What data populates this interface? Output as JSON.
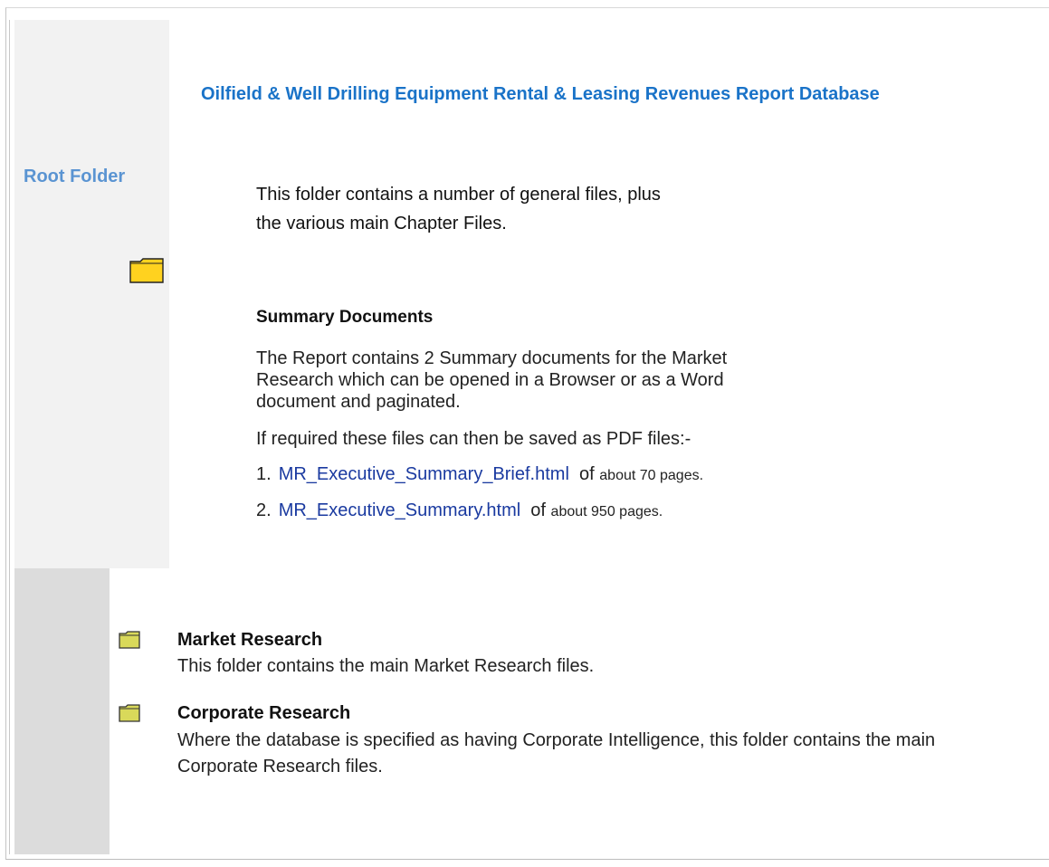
{
  "title": "Oilfield & Well Drilling Equipment Rental & Leasing Revenues Report Database",
  "left_label": "Root Folder",
  "intro_text": "This folder contains a number of general files, plus the various main Chapter Files.",
  "summary": {
    "heading": "Summary Documents",
    "paragraph1": "The Report contains 2 Summary documents for the Market Research which can be opened in a Browser or as a Word document and paginated.",
    "paragraph2": "If required these files can then be saved as PDF files:-",
    "items": [
      {
        "num": "1.",
        "link": "MR_Executive_Summary_Brief.html",
        "of": "of",
        "pages": "about 70 pages."
      },
      {
        "num": "2.",
        "link": "MR_Executive_Summary.html",
        "of": "of",
        "pages": "about 950 pages."
      }
    ]
  },
  "folders": [
    {
      "title": "Market Research",
      "description": "This folder contains the main Market Research files."
    },
    {
      "title": "Corporate Research",
      "description": "Where the database is specified as having Corporate Intelligence, this folder contains the main Corporate Research files."
    }
  ],
  "colors": {
    "title": "#1a73c8",
    "left_label": "#5a94d2",
    "link": "#1a3aa0",
    "folder_yellow": "#ffd21f",
    "folder_small": "#d9d95a"
  },
  "icons": [
    "folder-icon",
    "folder-icon",
    "folder-icon"
  ]
}
